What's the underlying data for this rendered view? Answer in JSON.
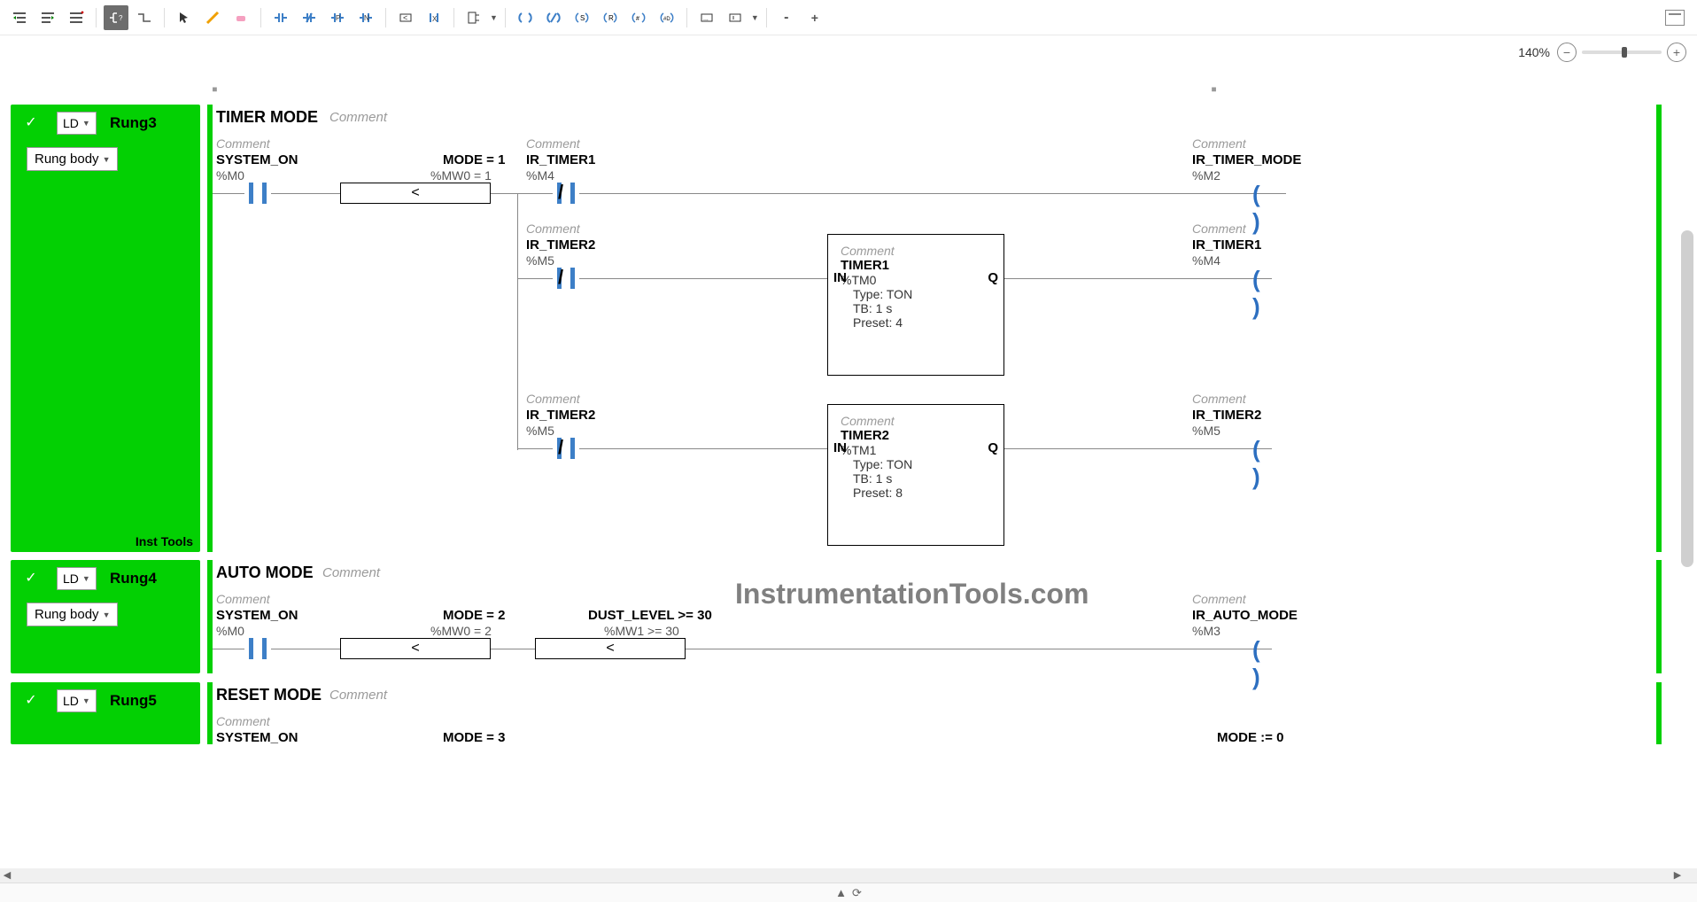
{
  "toolbar": {
    "zoom": "140%"
  },
  "watermark": "InstrumentationTools.com",
  "rungs": [
    {
      "id": "rung3",
      "side_lang": "LD",
      "side_title": "Rung3",
      "side_body": "Rung body",
      "side_footer": "Inst Tools",
      "section_title": "TIMER MODE",
      "section_comment": "Comment",
      "rows": [
        {
          "elements": [
            {
              "kind": "contact",
              "comment": "Comment",
              "name": "SYSTEM_ON",
              "addr": "%M0",
              "closed": false
            },
            {
              "kind": "compare",
              "name": "MODE = 1",
              "addr": "%MW0 = 1",
              "op": "<"
            },
            {
              "kind": "contact",
              "comment": "Comment",
              "name": "IR_TIMER1",
              "addr": "%M4",
              "closed": true
            },
            {
              "kind": "coil",
              "comment": "Comment",
              "name": "IR_TIMER_MODE",
              "addr": "%M2"
            }
          ]
        },
        {
          "elements": [
            {
              "kind": "contact",
              "comment": "Comment",
              "name": "IR_TIMER2",
              "addr": "%M5",
              "closed": true
            },
            {
              "kind": "fb",
              "comment": "Comment",
              "name": "TIMER1",
              "addr": "%TM0",
              "in": "IN",
              "out": "Q",
              "props": {
                "type": "Type: TON",
                "tb": "TB: 1 s",
                "preset": "Preset: 4"
              }
            },
            {
              "kind": "coil",
              "comment": "Comment",
              "name": "IR_TIMER1",
              "addr": "%M4"
            }
          ]
        },
        {
          "elements": [
            {
              "kind": "contact",
              "comment": "Comment",
              "name": "IR_TIMER2",
              "addr": "%M5",
              "closed": true
            },
            {
              "kind": "fb",
              "comment": "Comment",
              "name": "TIMER2",
              "addr": "%TM1",
              "in": "IN",
              "out": "Q",
              "props": {
                "type": "Type: TON",
                "tb": "TB: 1 s",
                "preset": "Preset: 8"
              }
            },
            {
              "kind": "coil",
              "comment": "Comment",
              "name": "IR_TIMER2",
              "addr": "%M5"
            }
          ]
        }
      ]
    },
    {
      "id": "rung4",
      "side_lang": "LD",
      "side_title": "Rung4",
      "side_body": "Rung body",
      "section_title": "AUTO MODE",
      "section_comment": "Comment",
      "rows": [
        {
          "elements": [
            {
              "kind": "contact",
              "comment": "Comment",
              "name": "SYSTEM_ON",
              "addr": "%M0",
              "closed": false
            },
            {
              "kind": "compare",
              "name": "MODE = 2",
              "addr": "%MW0 = 2",
              "op": "<"
            },
            {
              "kind": "compare",
              "name": "DUST_LEVEL >= 30",
              "addr": "%MW1 >= 30",
              "op": "<"
            },
            {
              "kind": "coil",
              "comment": "Comment",
              "name": "IR_AUTO_MODE",
              "addr": "%M3"
            }
          ]
        }
      ]
    },
    {
      "id": "rung5",
      "side_lang": "LD",
      "side_title": "Rung5",
      "section_title": "RESET MODE",
      "section_comment": "Comment",
      "rows": [
        {
          "elements": [
            {
              "kind": "contact",
              "comment": "Comment",
              "name": "SYSTEM_ON",
              "addr": "",
              "closed": false
            },
            {
              "kind": "compare",
              "name": "MODE = 3",
              "addr": "",
              "op": ""
            },
            {
              "kind": "assign",
              "name": "MODE := 0"
            }
          ]
        }
      ]
    }
  ]
}
